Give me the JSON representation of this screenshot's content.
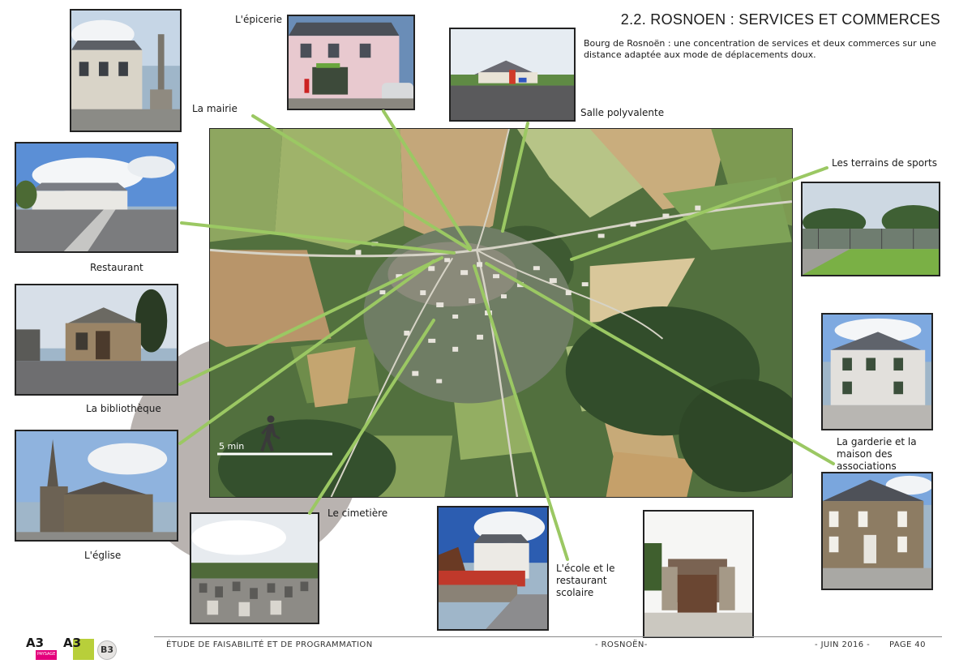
{
  "header": {
    "title": "2.2. ROSNOEN : SERVICES ET COMMERCES",
    "description": "Bourg de Rosnoën : une concentration de services et deux commerces sur une distance adaptée aux mode de déplacements doux."
  },
  "labels": {
    "epicerie": "L'épicerie",
    "mairie": "La mairie",
    "salle": "Salle polyvalente",
    "terrains": "Les terrains de sports",
    "restaurant": "Restaurant",
    "bibliotheque": "La bibliothèque",
    "eglise": "L'église",
    "cimetiere": "Le cimetière",
    "ecole_1": "L'école et le",
    "ecole_2": "restaurant",
    "ecole_3": "scolaire",
    "garderie_1": "La garderie et la",
    "garderie_2": "maison des",
    "garderie_3": "associations"
  },
  "walk_circle": {
    "label": "5 min",
    "icon": "pedestrian-icon"
  },
  "footer": {
    "study": "ÉTUDE DE FAISABILITÉ ET DE PROGRAMMATION",
    "place": "- ROSNOËN-",
    "date": "- JUIN 2016 -",
    "page": "PAGE 40"
  },
  "logos": {
    "a3_paysage_1": "A3",
    "a3_paysage_2": "PAYSAGE",
    "a3_b": "A3",
    "b3": "B3"
  },
  "colors": {
    "connector": "#9bc863",
    "walk_circle": "#b9b3b0",
    "logo_pink": "#e4007c",
    "logo_green": "#b8cf3a"
  }
}
